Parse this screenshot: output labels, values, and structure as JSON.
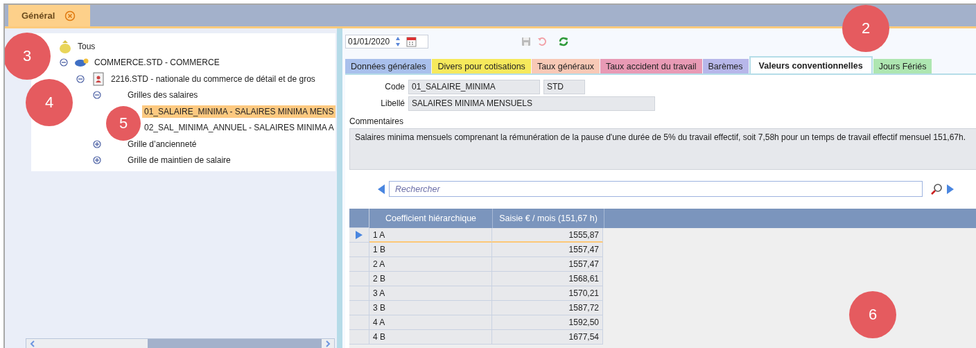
{
  "doc_tabs": [
    {
      "label": "Général",
      "selected": true
    }
  ],
  "tree": [
    {
      "label": "Tous",
      "kind": "all",
      "selected": false,
      "children": [
        {
          "label": "COMMERCE.STD - COMMERCE",
          "kind": "sector",
          "expanded": true,
          "selected": false,
          "children": [
            {
              "label": "2216.STD - nationale du commerce de détail et de gros",
              "kind": "convention",
              "expanded": true,
              "selected": false,
              "children": [
                {
                  "label": "Grilles des salaires",
                  "expanded": true,
                  "selected": false,
                  "children": [
                    {
                      "label": "01_SALAIRE_MINIMA - SALAIRES MINIMA MENS",
                      "selected": true
                    },
                    {
                      "label": "02_SAL_MINIMA_ANNUEL - SALAIRES MINIMA A",
                      "selected": false
                    }
                  ]
                },
                {
                  "label": "Grille d’ancienneté",
                  "expanded": false,
                  "selected": false
                },
                {
                  "label": "Grille de maintien de salaire",
                  "expanded": false,
                  "selected": false
                }
              ]
            }
          ]
        }
      ]
    }
  ],
  "toolbar": {
    "date": "01/01/2020"
  },
  "section_tabs": [
    {
      "label": "Données générales",
      "color": "#a9c0ec",
      "selected": false
    },
    {
      "label": "Divers pour cotisations",
      "color": "#f6e95c",
      "selected": false
    },
    {
      "label": "Taux généraux",
      "color": "#f8c9b6",
      "selected": false
    },
    {
      "label": "Taux accident du travail",
      "color": "#e89ab5",
      "selected": false
    },
    {
      "label": "Barèmes",
      "color": "#b7b7ea",
      "selected": false
    },
    {
      "label": "Valeurs conventionnelles",
      "color": "#ffffff",
      "selected": true
    },
    {
      "label": "Jours Fériés",
      "color": "#aee6b1",
      "selected": false
    }
  ],
  "form": {
    "code": {
      "label": "Code",
      "value": "01_SALAIRE_MINIMA",
      "suffix": "STD"
    },
    "libelle": {
      "label": "Libellé",
      "value": "SALAIRES MINIMA MENSUELS"
    },
    "comments": {
      "label": "Commentaires",
      "value": "Salaires minima mensuels comprenant la rémunération de la pause d'une durée de 5% du travail effectif, soit 7,58h pour un temps de travail effectif mensuel 151,67h."
    }
  },
  "search": {
    "placeholder": "Rechercher"
  },
  "table": {
    "columns": [
      "Coefficient hiérarchique",
      "Saisie € / mois (151,67 h)"
    ],
    "rows": [
      {
        "cells": [
          "1 A",
          "1555,87"
        ],
        "selected": true
      },
      {
        "cells": [
          "1 B",
          "1557,47"
        ],
        "selected": false
      },
      {
        "cells": [
          "2 A",
          "1557,47"
        ],
        "selected": false
      },
      {
        "cells": [
          "2 B",
          "1568,61"
        ],
        "selected": false
      },
      {
        "cells": [
          "3 A",
          "1570,21"
        ],
        "selected": false
      },
      {
        "cells": [
          "3 B",
          "1587,72"
        ],
        "selected": false
      },
      {
        "cells": [
          "4 A",
          "1592,50"
        ],
        "selected": false
      },
      {
        "cells": [
          "4 B",
          "1677,54"
        ],
        "selected": false
      }
    ]
  },
  "callouts": [
    "2",
    "3",
    "4",
    "5",
    "6"
  ]
}
